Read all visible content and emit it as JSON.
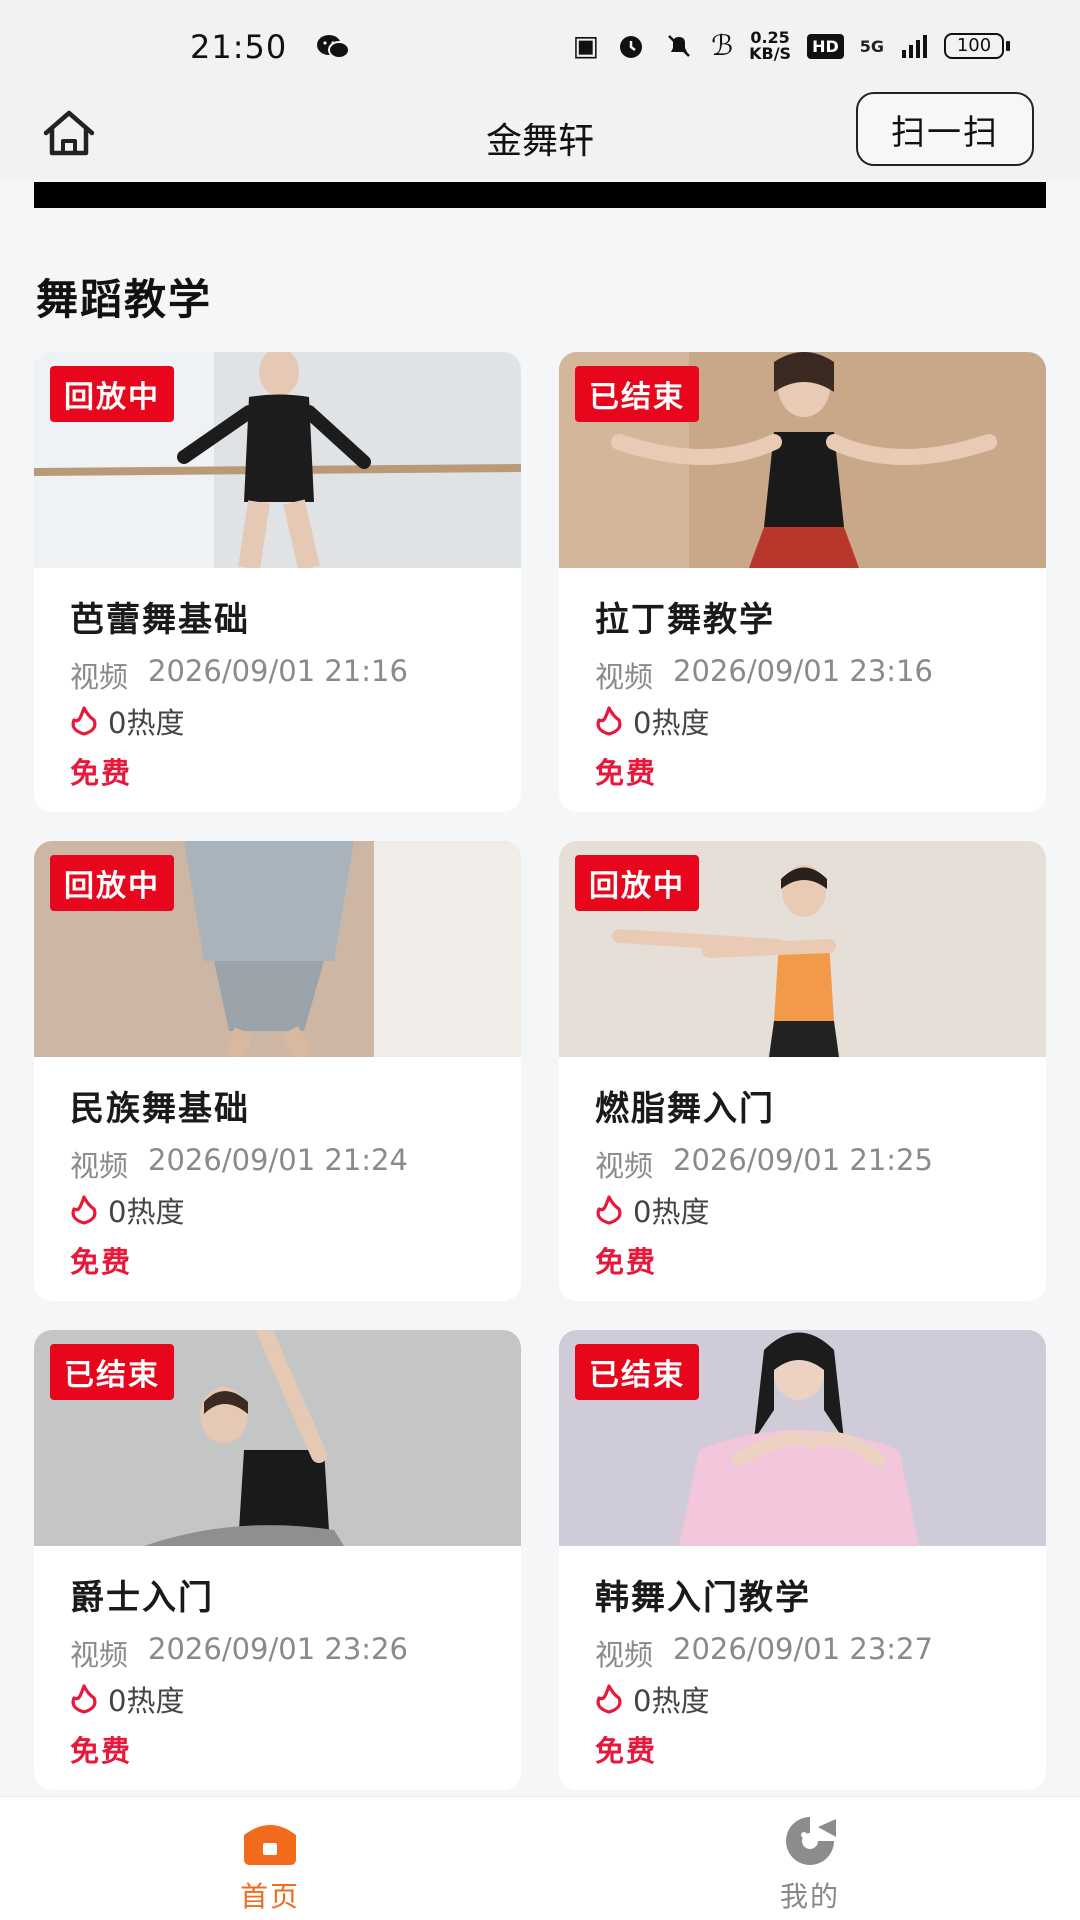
{
  "status_bar": {
    "time": "21:50",
    "speed_value": "0.25",
    "speed_unit": "KB/S",
    "hd": "HD",
    "network": "5G",
    "battery": "100"
  },
  "header": {
    "title": "金舞轩",
    "scan_label": "扫一扫"
  },
  "section": {
    "title": "舞蹈教学"
  },
  "cards": [
    {
      "badge": "回放中",
      "title": "芭蕾舞基础",
      "type": "视频",
      "time": "2026/09/01 21:16",
      "heat": "0热度",
      "price": "免费",
      "bg": "#dfe3e6"
    },
    {
      "badge": "已结束",
      "title": "拉丁舞教学",
      "type": "视频",
      "time": "2026/09/01 23:16",
      "heat": "0热度",
      "price": "免费",
      "bg": "#c9a88a"
    },
    {
      "badge": "回放中",
      "title": "民族舞基础",
      "type": "视频",
      "time": "2026/09/01 21:24",
      "heat": "0热度",
      "price": "免费",
      "bg": "#cdb7a4"
    },
    {
      "badge": "回放中",
      "title": "燃脂舞入门",
      "type": "视频",
      "time": "2026/09/01 21:25",
      "heat": "0热度",
      "price": "免费",
      "bg": "#e6dfd8"
    },
    {
      "badge": "已结束",
      "title": "爵士入门",
      "type": "视频",
      "time": "2026/09/01 23:26",
      "heat": "0热度",
      "price": "免费",
      "bg": "#c4c6c6"
    },
    {
      "badge": "已结束",
      "title": "韩舞入门教学",
      "type": "视频",
      "time": "2026/09/01 23:27",
      "heat": "0热度",
      "price": "免费",
      "bg": "#cfcbd8"
    }
  ],
  "bottom_nav": {
    "home_label": "首页",
    "mine_label": "我的"
  },
  "colors": {
    "badge": "#e8061c",
    "price": "#e8183a",
    "active_nav": "#f26a1b"
  }
}
